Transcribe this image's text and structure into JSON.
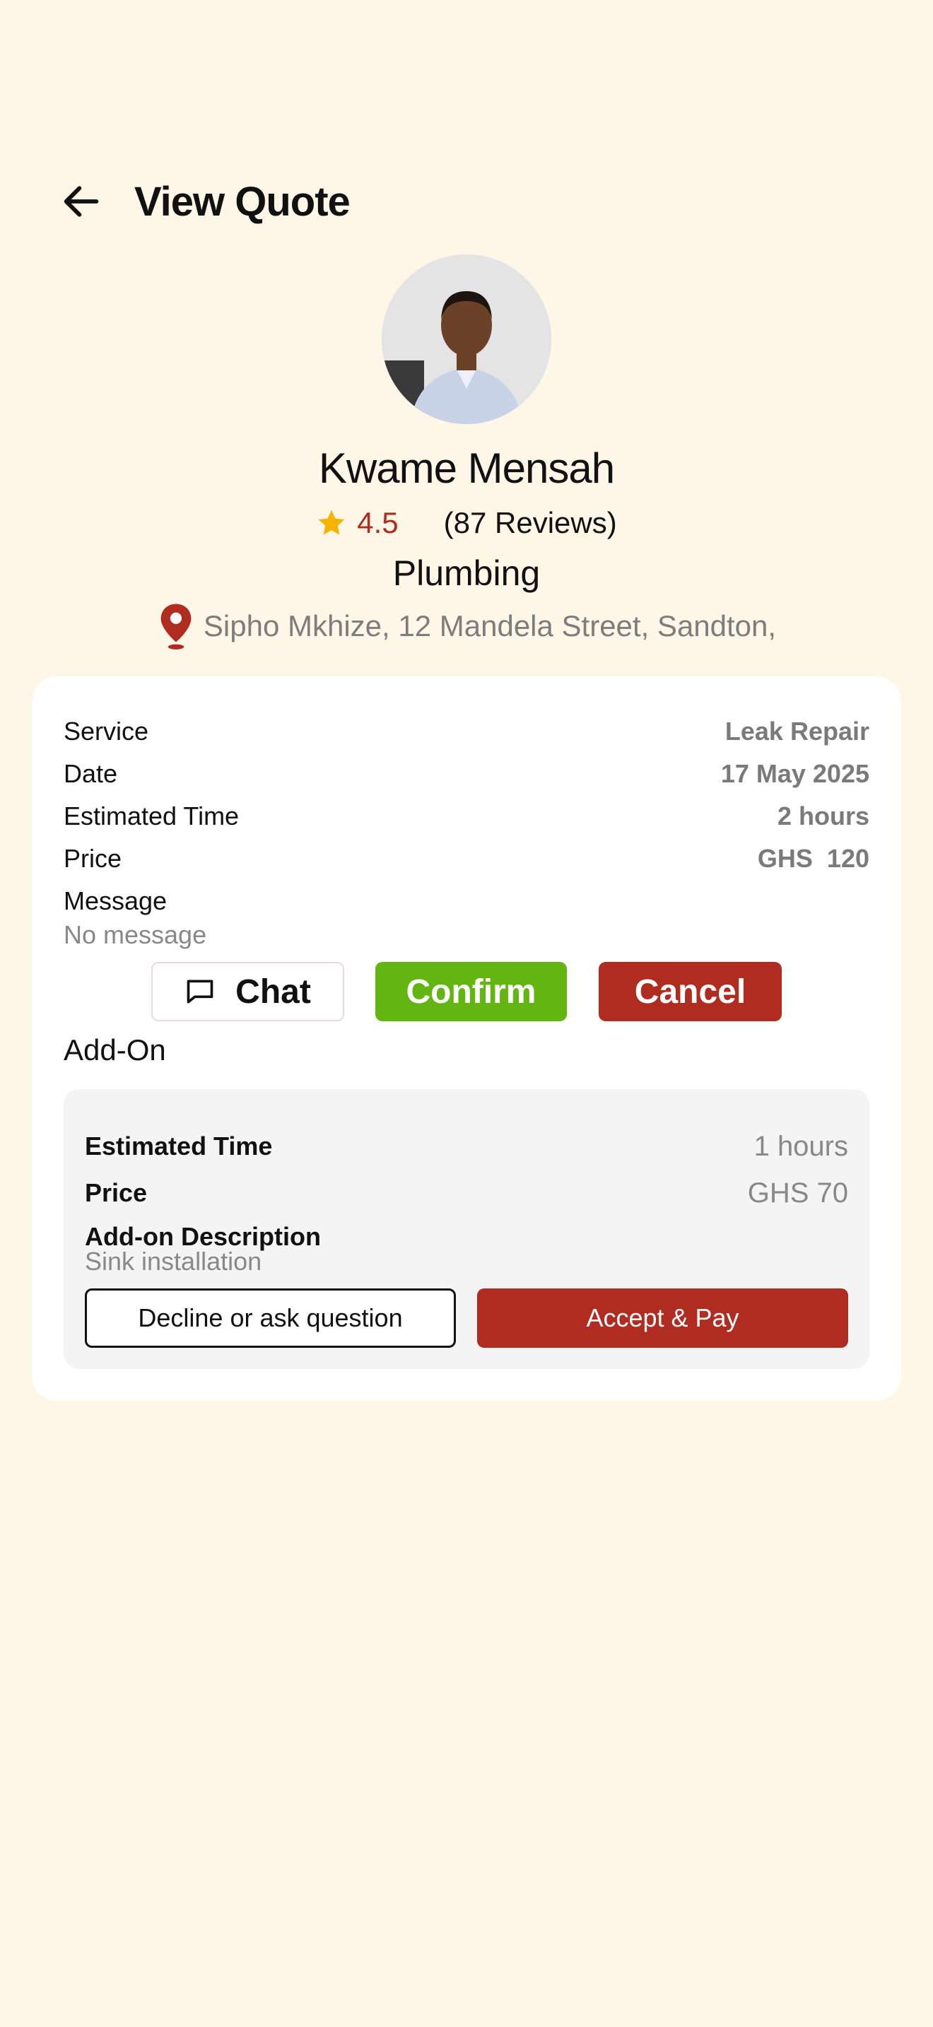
{
  "header": {
    "title": "View Quote",
    "back_icon": "arrow-left-icon"
  },
  "provider": {
    "name": "Kwame Mensah",
    "rating": "4.5",
    "reviews": "(87 Reviews)",
    "category": "Plumbing",
    "location": "Sipho Mkhize, 12 Mandela Street, Sandton,"
  },
  "quote": {
    "service_label": "Service",
    "service_value": "Leak Repair",
    "date_label": "Date",
    "date_value": "17 May 2025",
    "time_label": "Estimated Time",
    "time_value": "2 hours",
    "price_label": "Price",
    "price_value": "GHS  120",
    "message_label": "Message",
    "message_value": "No message"
  },
  "actions": {
    "chat": "Chat",
    "confirm": "Confirm",
    "cancel": "Cancel"
  },
  "addon": {
    "title": "Add-On",
    "time_label": "Estimated Time",
    "time_value": "1 hours",
    "price_label": "Price",
    "price_value": "GHS 70",
    "desc_label": "Add-on Description",
    "desc_value": "Sink installation",
    "decline": "Decline or ask question",
    "accept": "Accept & Pay"
  },
  "colors": {
    "background": "#FEF6E7",
    "accent_red": "#B02C20",
    "confirm_green": "#63B611",
    "star": "#F5B400"
  }
}
